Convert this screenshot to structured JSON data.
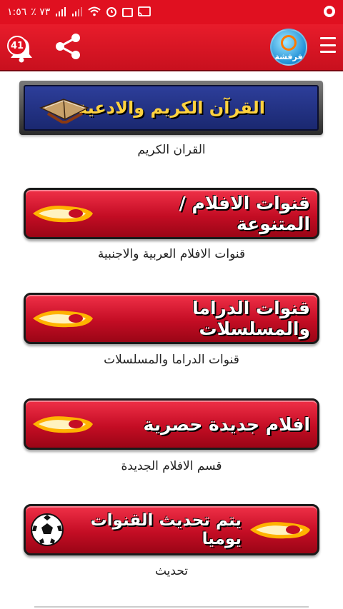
{
  "status": {
    "time": "١:٥٦",
    "battery": "٪ ٧٣",
    "icons": [
      "battery-icon",
      "signal-icon",
      "signal-icon",
      "wifi-icon",
      "alarm-icon",
      "nfc-icon",
      "cast-icon",
      "app-notification-icon"
    ]
  },
  "appbar": {
    "notification_count": "41",
    "logo_text": "فرفشة",
    "icons": [
      "bell-icon",
      "share-icon",
      "menu-icon"
    ]
  },
  "items": [
    {
      "button": "القرآن الكريم والادعية",
      "caption": "القران الكريم",
      "icon": "quran-book-icon"
    },
    {
      "button": "قنوات الافلام / المتنوعة",
      "caption": "قنوات الافلام العربية والاجنبية",
      "icon": "flame-icon"
    },
    {
      "button": "قنوات الدراما والمسلسلات",
      "caption": "قنوات الدراما والمسلسلات",
      "icon": "flame-icon"
    },
    {
      "button": "افلام جديدة حصرية",
      "caption": "قسم الافلام الجديدة",
      "icon": "flame-icon"
    },
    {
      "button": "يتم تحديث القنوات يوميا",
      "caption": "تحديث",
      "icon": "flame-icon",
      "extra_icon": "soccer-ball-icon"
    }
  ],
  "colors": {
    "brand_red": "#e01020",
    "button_red": "#c40d24",
    "quran_blue": "#1f2c80",
    "quran_gold": "#ffd23f"
  }
}
